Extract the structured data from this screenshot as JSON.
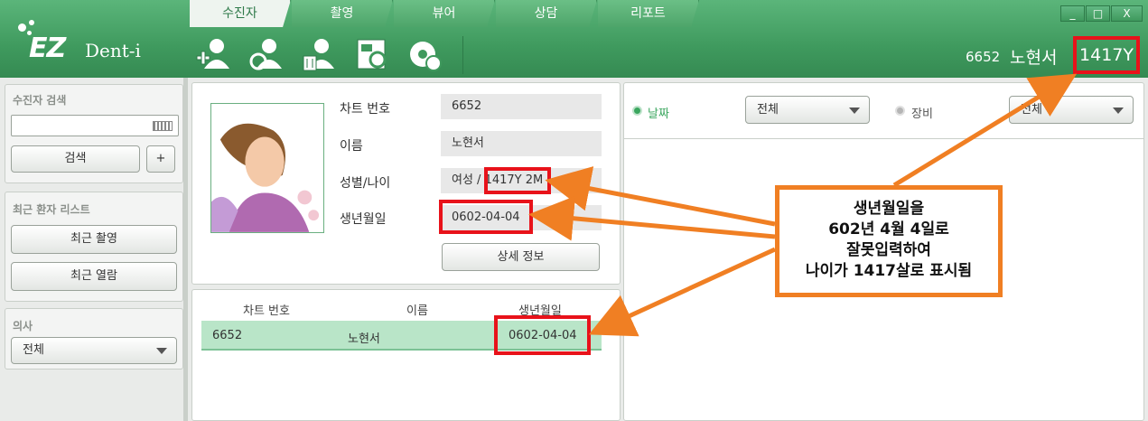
{
  "app": {
    "logo_main": "EZ",
    "logo_sub": "Dent-i"
  },
  "tabs": [
    {
      "label": "수진자",
      "active": true
    },
    {
      "label": "촬영",
      "active": false
    },
    {
      "label": "뷰어",
      "active": false
    },
    {
      "label": "상담",
      "active": false
    },
    {
      "label": "리포트",
      "active": false
    }
  ],
  "toolbar": {
    "icons": [
      "add-patient-icon",
      "edit-patient-icon",
      "delete-patient-icon",
      "patient-card-icon",
      "sync-icon"
    ]
  },
  "header_patient": {
    "chart_no": "6652",
    "name": "노현서",
    "age": "1417Y"
  },
  "window_controls": {
    "minimize": "_",
    "maximize": "□",
    "close": "X"
  },
  "sidebar": {
    "search": {
      "title": "수진자 검색",
      "button": "검색",
      "plus": "+",
      "value": ""
    },
    "recent": {
      "title": "최근 환자 리스트",
      "recent_capture": "최근 촬영",
      "recent_view": "최근 열람"
    },
    "doctor": {
      "title": "의사",
      "selected": "전체"
    }
  },
  "patient_info": {
    "fields": [
      {
        "label": "차트 번호",
        "value": "6652"
      },
      {
        "label": "이름",
        "value": "노현서"
      },
      {
        "label": "성별/나이",
        "value": "여성 / 1417Y 2M"
      },
      {
        "label": "생년월일",
        "value": "0602-04-04"
      }
    ],
    "detail_button": "상세 정보"
  },
  "patient_list": {
    "headers": [
      "차트 번호",
      "이름",
      "생년월일"
    ],
    "rows": [
      {
        "chart_no": "6652",
        "name": "노현서",
        "birth": "0602-04-04"
      }
    ]
  },
  "right_panel": {
    "radio_date": "날짜",
    "filter_date": "전체",
    "radio_device": "장비",
    "filter_device": "전체"
  },
  "callout": {
    "lines": [
      "생년월일을",
      "602년 4월 4일로",
      "잘못입력하여",
      "나이가 1417살로 표시됨"
    ],
    "border_color": "#f07f23"
  },
  "colors": {
    "header_green": "#4ea56a",
    "highlight_red": "#e8121a",
    "row_green": "#b9e5c8"
  }
}
